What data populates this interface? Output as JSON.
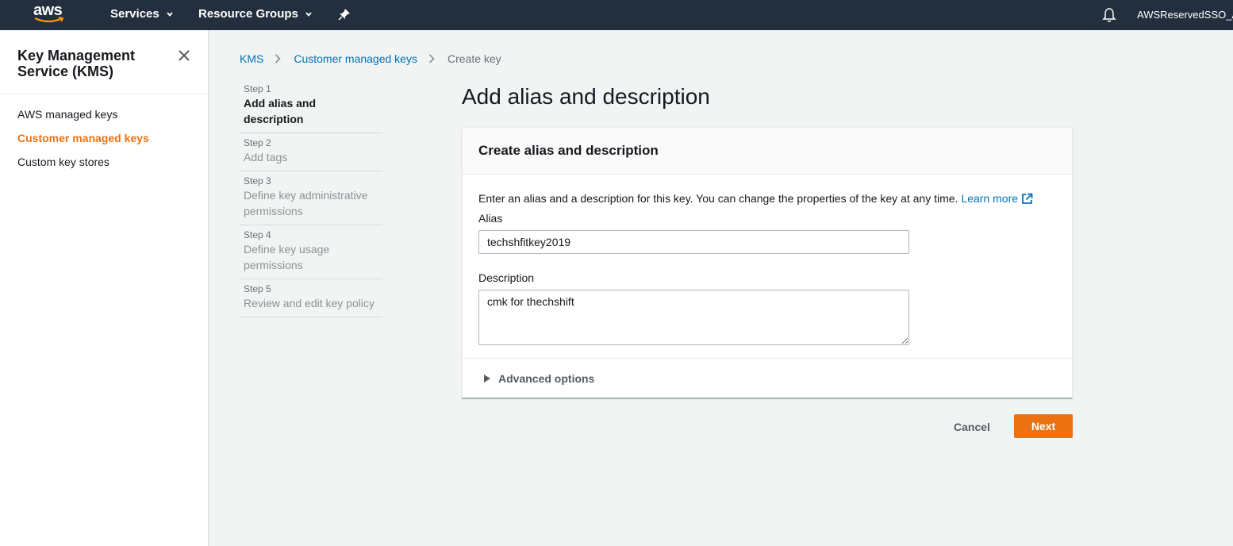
{
  "topnav": {
    "logo_text": "aws",
    "services_label": "Services",
    "resource_groups_label": "Resource Groups",
    "account_label": "AWSReservedSSO_A"
  },
  "sidenav": {
    "title": "Key Management Service (KMS)",
    "items": [
      {
        "label": "AWS managed keys",
        "active": false
      },
      {
        "label": "Customer managed keys",
        "active": true
      },
      {
        "label": "Custom key stores",
        "active": false
      }
    ]
  },
  "breadcrumb": {
    "items": [
      "KMS",
      "Customer managed keys"
    ],
    "current": "Create key"
  },
  "steps": [
    {
      "num": "Step 1",
      "title": "Add alias and description",
      "active": true
    },
    {
      "num": "Step 2",
      "title": "Add tags",
      "active": false
    },
    {
      "num": "Step 3",
      "title": "Define key administrative permissions",
      "active": false
    },
    {
      "num": "Step 4",
      "title": "Define key usage permissions",
      "active": false
    },
    {
      "num": "Step 5",
      "title": "Review and edit key policy",
      "active": false
    }
  ],
  "main": {
    "page_title": "Add alias and description",
    "panel_title": "Create alias and description",
    "intro_text": "Enter an alias and a description for this key. You can change the properties of the key at any time.",
    "learn_more": "Learn more",
    "alias_label": "Alias",
    "alias_value": "techshfitkey2019",
    "description_label": "Description",
    "description_value": "cmk for thechshift",
    "advanced_options": "Advanced options",
    "cancel_label": "Cancel",
    "next_label": "Next"
  },
  "colors": {
    "nav_bg": "#232f3e",
    "accent": "#ec7211",
    "link": "#0073bb"
  }
}
